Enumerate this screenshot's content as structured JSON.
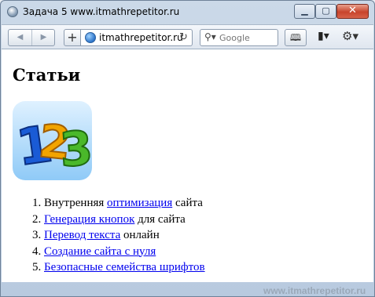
{
  "window": {
    "title": "Задача 5 www.itmathrepetitor.ru"
  },
  "toolbar": {
    "back_icon": "◀",
    "forward_icon": "▶",
    "add_icon": "+",
    "url": "itmathrepetitor.ru",
    "reload_icon": "↻",
    "search_placeholder": "Google",
    "search_icon": "magnifier-dropdown-icon",
    "reader_icon": "🕮",
    "page_menu_icon": "▮▾",
    "gear_icon": "⚙▾"
  },
  "page": {
    "title": "Статьи",
    "logo_text": "123",
    "articles": [
      {
        "pre": "Внутренняя ",
        "link": "оптимизация",
        "post": " сайта"
      },
      {
        "pre": "",
        "link": "Генерация кнопок",
        "post": " для сайта"
      },
      {
        "pre": "",
        "link": "Перевод текста",
        "post": " онлайн"
      },
      {
        "pre": "",
        "link": "Создание сайта с нуля",
        "post": ""
      },
      {
        "pre": "",
        "link": "Безопасные семейства шрифтов",
        "post": ""
      }
    ]
  },
  "watermark": "www.itmathrepetitor.ru",
  "colors": {
    "link": "#0000ee",
    "close_button": "#c8442c",
    "digit_one": "#1a5bd6",
    "digit_two": "#f2a400",
    "digit_three": "#4ab82a"
  }
}
